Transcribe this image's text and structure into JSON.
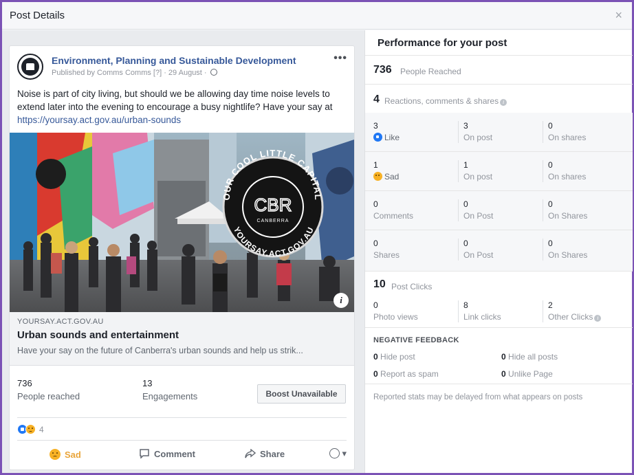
{
  "dialog": {
    "title": "Post Details",
    "close_glyph": "×"
  },
  "post": {
    "page_name": "Environment, Planning and Sustainable Development",
    "published_by": "Published by Comms Comms [?] · 29 August ·",
    "more_glyph": "•••",
    "text_main": "Noise is part of city living, but should we be allowing day time noise levels to extend later into the evening to encourage a busy nightlife? Have your say at ",
    "text_link": "https://yoursay.act.gov.au/urban-sounds",
    "image_badge": {
      "top_text": "OUR COOL LITTLE CAPITAL",
      "logo_text": "CBR",
      "sub_text": "CANBERRA",
      "bottom_text": "YOURSAY.ACT.GOV.AU"
    },
    "info_glyph": "i",
    "link_domain": "YOURSAY.ACT.GOV.AU",
    "link_title": "Urban sounds and entertainment",
    "link_desc": "Have your say on the future of Canberra's urban sounds and help us strik..."
  },
  "post_stats": {
    "reached_num": "736",
    "reached_label": "People reached",
    "engagements_num": "13",
    "engagements_label": "Engagements",
    "boost_label": "Boost Unavailable"
  },
  "reactions": {
    "count": "4"
  },
  "actions": {
    "sad": "Sad",
    "comment": "Comment",
    "share": "Share"
  },
  "performance": {
    "title": "Performance for your post",
    "reached_num": "736",
    "reached_label": "People Reached",
    "rcs_num": "4",
    "rcs_label": "Reactions, comments & shares",
    "rows": [
      {
        "c1n": "3",
        "c1l": "Like",
        "c2n": "3",
        "c2l": "On post",
        "c3n": "0",
        "c3l": "On shares"
      },
      {
        "c1n": "1",
        "c1l": "Sad",
        "c2n": "1",
        "c2l": "On post",
        "c3n": "0",
        "c3l": "On shares"
      },
      {
        "c1n": "0",
        "c1l": "Comments",
        "c2n": "0",
        "c2l": "On Post",
        "c3n": "0",
        "c3l": "On Shares"
      },
      {
        "c1n": "0",
        "c1l": "Shares",
        "c2n": "0",
        "c2l": "On Post",
        "c3n": "0",
        "c3l": "On Shares"
      }
    ],
    "clicks_num": "10",
    "clicks_label": "Post Clicks",
    "clicks_row": {
      "c1n": "0",
      "c1l": "Photo views",
      "c2n": "8",
      "c2l": "Link clicks",
      "c3n": "2",
      "c3l": "Other Clicks"
    },
    "negative_title": "NEGATIVE FEEDBACK",
    "negative": [
      {
        "num": "0",
        "label": "Hide post"
      },
      {
        "num": "0",
        "label": "Hide all posts"
      },
      {
        "num": "0",
        "label": "Report as spam"
      },
      {
        "num": "0",
        "label": "Unlike Page"
      }
    ],
    "note": "Reported stats may be delayed from what appears on posts"
  }
}
